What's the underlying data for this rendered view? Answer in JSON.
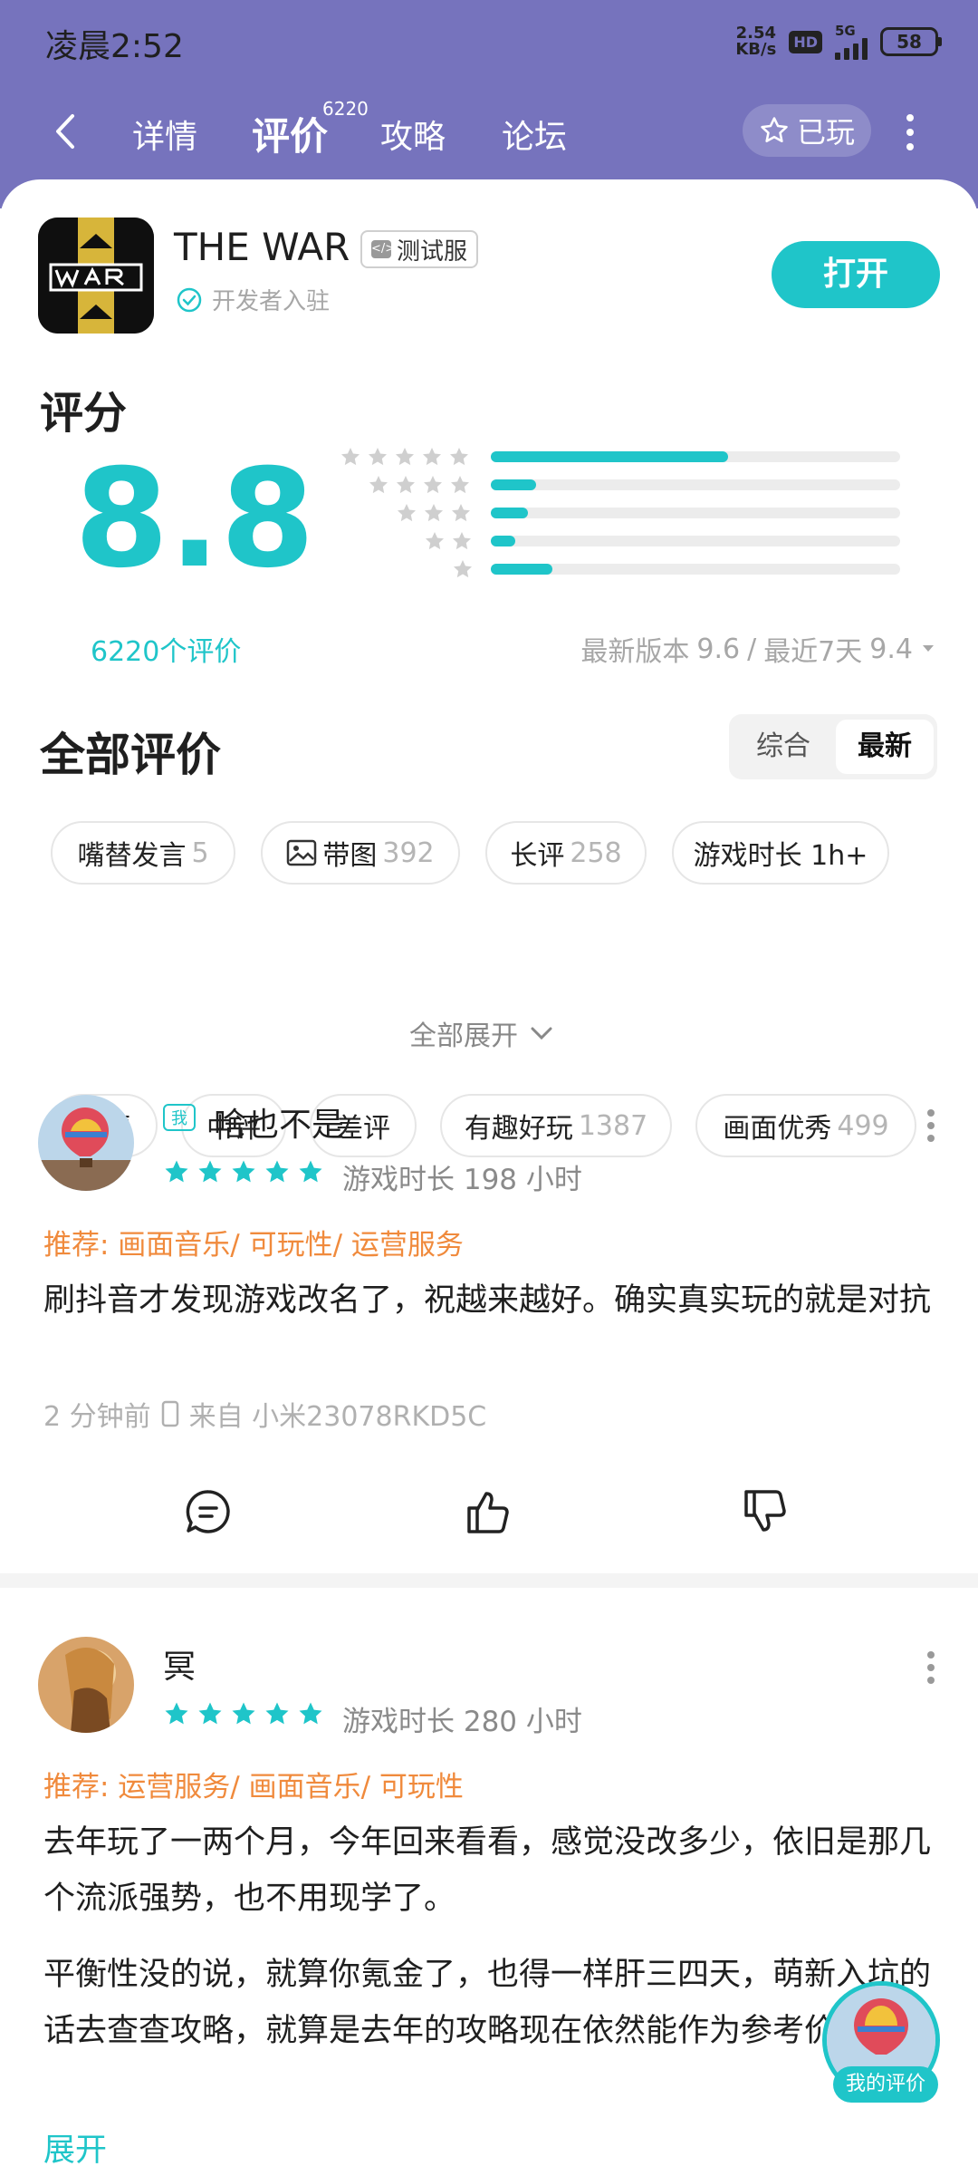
{
  "status_bar": {
    "time": "凌晨2:52",
    "net_speed_value": "2.54",
    "net_speed_unit": "KB/s",
    "hd": "HD",
    "signal_label": "5G",
    "battery": "58"
  },
  "nav": {
    "tabs": [
      "详情",
      "评价",
      "攻略",
      "论坛"
    ],
    "active_tab": "评价",
    "review_tab_count": "6220",
    "played_label": "已玩"
  },
  "app": {
    "name": "THE WAR",
    "badge": "测试服",
    "developer_label": "开发者入驻",
    "open_button": "打开"
  },
  "rating": {
    "title": "评分",
    "score": "8.8",
    "review_count": "6220个评价",
    "distribution": [
      {
        "stars": 5,
        "fraction": 0.58
      },
      {
        "stars": 4,
        "fraction": 0.11
      },
      {
        "stars": 3,
        "fraction": 0.09
      },
      {
        "stars": 2,
        "fraction": 0.06
      },
      {
        "stars": 1,
        "fraction": 0.15
      }
    ],
    "latest_version_label": "最新版本",
    "latest_version_score": "9.6",
    "separator": "/",
    "recent_label": "最近7天",
    "recent_score": "9.4"
  },
  "reviews_section": {
    "title": "全部评价",
    "sort_options": [
      "综合",
      "最新"
    ],
    "active_sort": "最新",
    "chips": [
      {
        "label": "嘴替发言",
        "count": "5"
      },
      {
        "label": "带图",
        "count": "392"
      },
      {
        "label": "长评",
        "count": "258"
      },
      {
        "label": "游戏时长 1h+",
        "count": ""
      },
      {
        "label": "好评",
        "count": ""
      },
      {
        "label": "中评",
        "count": ""
      },
      {
        "label": "差评",
        "count": ""
      },
      {
        "label": "有趣好玩",
        "count": "1387"
      },
      {
        "label": "画面优秀",
        "count": "499"
      }
    ],
    "expand_all": "全部展开"
  },
  "reviews": [
    {
      "is_me_badge": "我",
      "username": "啥也不是",
      "stars": 5,
      "playtime": "游戏时长 198 小时",
      "recommend": "推荐: 画面音乐/ 可玩性/ 运营服务",
      "text": [
        "刷抖音才发现游戏改名了，祝越来越好。确实真实玩的就是对抗"
      ],
      "time_ago": "2 分钟前",
      "device": "来自 小米23078RKD5C"
    },
    {
      "username": "冥",
      "stars": 5,
      "playtime": "游戏时长 280 小时",
      "recommend": "推荐: 运营服务/ 画面音乐/ 可玩性",
      "text": [
        "去年玩了一两个月，今年回来看看，感觉没改多少，依旧是那几个流派强势，也不用现学了。",
        "平衡性没的说，就算你氪金了，也得一样肝三四天，萌新入坑的话去查查攻略，就算是去年的攻略现在依然能作为参考价值。 ..."
      ],
      "expand": "展开"
    }
  ],
  "fab": {
    "label": "我的评价"
  },
  "colors": {
    "header": "#7673bd",
    "accent": "#1fc5c9",
    "recommend": "#f08a3c"
  }
}
